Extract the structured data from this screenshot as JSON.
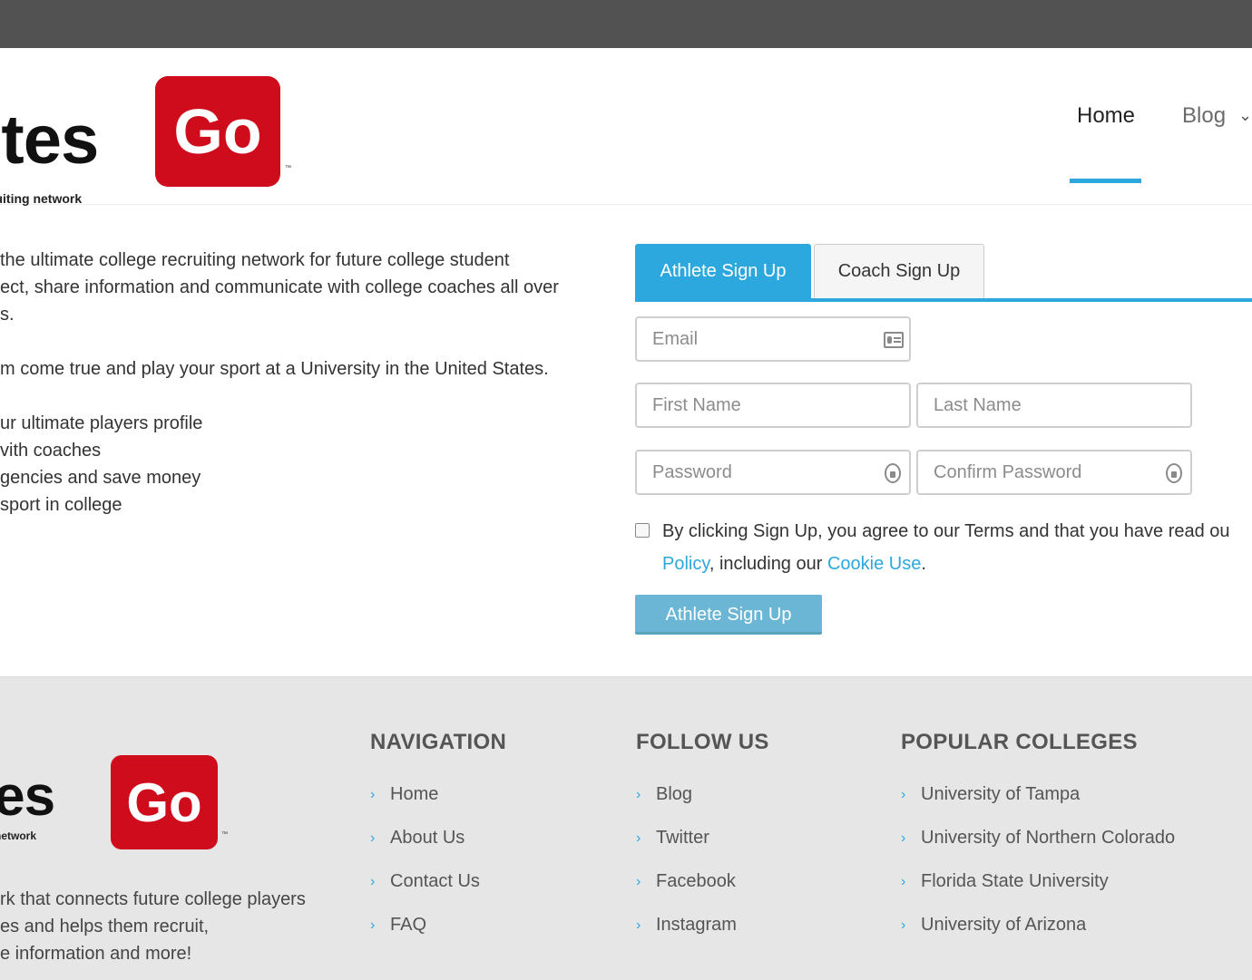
{
  "logo": {
    "word": "letes",
    "box_text": "Go",
    "tagline": "ege recruiting network",
    "tm": "™"
  },
  "footer_logo": {
    "word": "etes",
    "box_text": "Go",
    "tagline": "ecruiting network",
    "tm": "™"
  },
  "nav": {
    "home": "Home",
    "blog": "Blog"
  },
  "intro": {
    "lines_a": [
      "the ultimate college recruiting network for future college student",
      "ect, share information and communicate with college coaches all over",
      "s."
    ],
    "line_b": "m come true and play your sport at a University in the United States.",
    "lines_c": [
      "ur ultimate players profile",
      "vith coaches",
      "gencies and save money",
      "sport in college"
    ]
  },
  "tabs": {
    "athlete": "Athlete Sign Up",
    "coach": "Coach Sign Up"
  },
  "form": {
    "email_placeholder": "Email",
    "first_placeholder": "First Name",
    "last_placeholder": "Last Name",
    "password_placeholder": "Password",
    "confirm_placeholder": "Confirm Password",
    "terms_line1": "By clicking Sign Up, you agree to our Terms and that you have read ou",
    "policy_link": "Policy",
    "terms_mid": ", including our ",
    "cookie_link": "Cookie Use",
    "terms_end": ".",
    "submit": "Athlete Sign Up"
  },
  "footer": {
    "desc": [
      "rk that connects future college players",
      "es and helps them recruit,",
      "e information and more!"
    ],
    "navigation": {
      "title": "NAVIGATION",
      "items": [
        "Home",
        "About Us",
        "Contact Us",
        "FAQ"
      ]
    },
    "follow": {
      "title": "FOLLOW US",
      "items": [
        "Blog",
        "Twitter",
        "Facebook",
        "Instagram"
      ]
    },
    "colleges": {
      "title": "POPULAR COLLEGES",
      "items": [
        "University of Tampa",
        "University of Northern Colorado",
        "Florida State University",
        "University of Arizona"
      ]
    }
  },
  "colors": {
    "accent": "#2ca8de",
    "brand_red": "#cf0c1c",
    "topbar": "#525252",
    "footer_bg": "#e6e6e6"
  }
}
